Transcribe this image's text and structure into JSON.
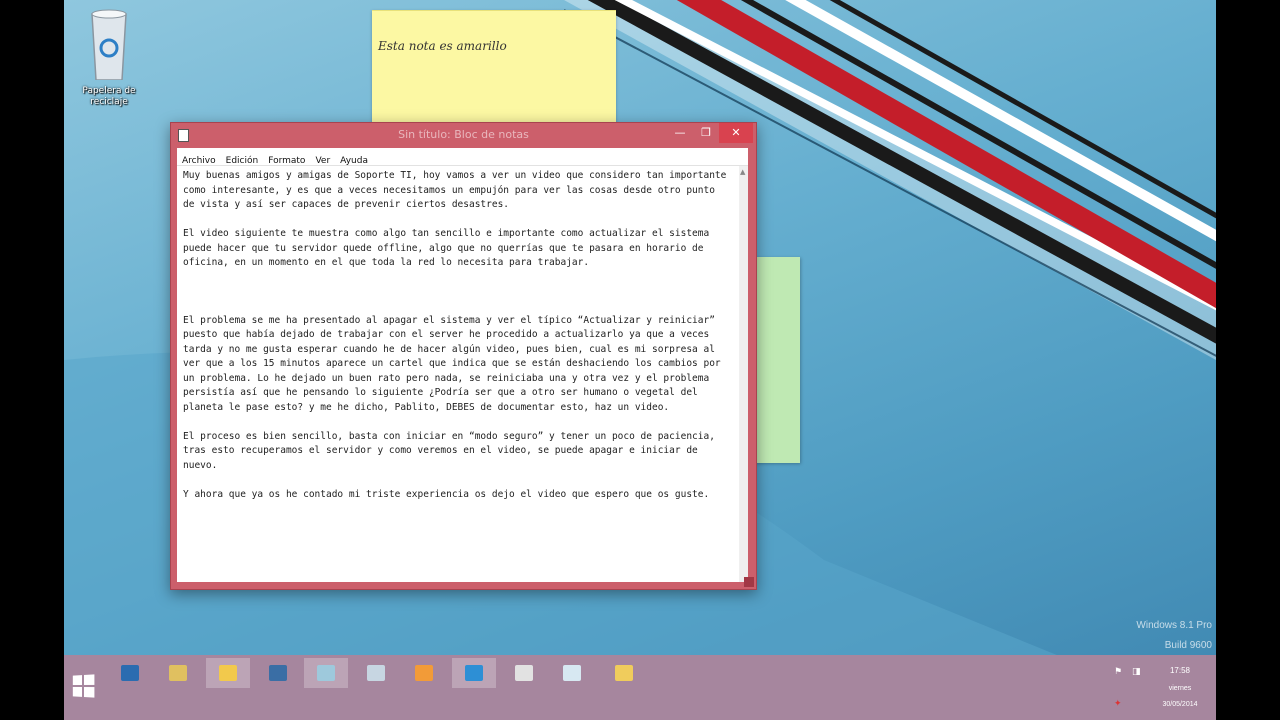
{
  "desktop": {
    "recycle_bin_label": "Papelera de reciclaje",
    "sticky_note_text": "Esta nota es amarillo",
    "watermark_line1": "Windows 8.1 Pro",
    "watermark_line2": "Build 9600"
  },
  "notepad": {
    "title": "Sin título: Bloc de notas",
    "menu": [
      "Archivo",
      "Edición",
      "Formato",
      "Ver",
      "Ayuda"
    ],
    "controls": {
      "minimize": "—",
      "maximize": "❐",
      "close": "✕"
    },
    "paragraphs": [
      "Muy buenas amigos y amigas de Soporte TI, hoy vamos a ver un video que considero tan importante como interesante, y es que a veces necesitamos un empujón para ver las cosas desde otro punto de vista y así ser capaces de prevenir ciertos desastres.",
      "El video siguiente te muestra como algo tan sencillo e importante como actualizar el sistema puede hacer que tu servidor quede offline, algo que no querrías que te pasara en horario de oficina, en un momento en el que toda la red lo necesita para trabajar.",
      "El problema se me ha presentado al apagar el sistema y ver el típico “Actualizar y reiniciar” puesto que había dejado de trabajar con el server he procedido a actualizarlo ya que a veces tarda y no me gusta esperar cuando he de hacer algún video, pues bien, cual es mi sorpresa al ver que a los 15 minutos aparece un cartel que indica que se están deshaciendo los cambios por un problema. Lo he dejado un buen rato pero nada, se reiniciaba una y otra vez y el problema persistía así que he pensando lo siguiente ¿Podría ser que a otro ser humano o vegetal del planeta le pase esto? y me he dicho, Pablito, DEBES de documentar esto, haz un video.",
      "El proceso es bien sencillo, basta con iniciar en “modo seguro” y tener un poco de paciencia, tras esto recuperamos el servidor y como veremos en el video, se puede apagar e iniciar de nuevo.",
      "Y ahora que ya os he contado mi triste experiencia os dejo el video que espero que os guste."
    ]
  },
  "taskbar": {
    "pinned": [
      {
        "name": "powershell",
        "color": "#2b6cb0"
      },
      {
        "name": "paint",
        "color": "#e0c060"
      },
      {
        "name": "file-explorer",
        "color": "#f2c94c"
      },
      {
        "name": "server-manager",
        "color": "#3a6ea5"
      },
      {
        "name": "notepad",
        "color": "#9ec9dc"
      },
      {
        "name": "photos",
        "color": "#c7d6e2"
      },
      {
        "name": "media-player",
        "color": "#f29b38"
      },
      {
        "name": "internet-explorer",
        "color": "#2d8fd5"
      },
      {
        "name": "remote-desktop",
        "color": "#e2e2e2"
      },
      {
        "name": "document",
        "color": "#d7e8f2"
      },
      {
        "name": "folder",
        "color": "#f0cc5c"
      }
    ],
    "clock_time": "17:58",
    "clock_day": "viernes",
    "clock_date": "30/05/2014"
  }
}
